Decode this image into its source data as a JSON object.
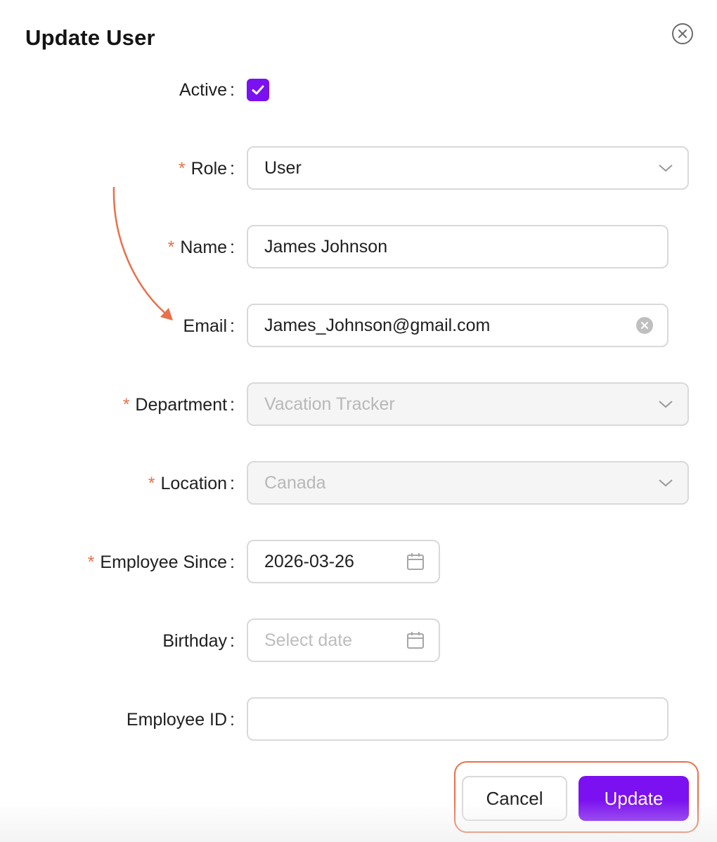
{
  "modal": {
    "title": "Update User",
    "close_icon": "close-circle-icon"
  },
  "form": {
    "active": {
      "label": "Active",
      "required": false,
      "checked": true
    },
    "role": {
      "label": "Role",
      "required": true,
      "value": "User",
      "icon": "chevron-down-icon"
    },
    "name": {
      "label": "Name",
      "required": true,
      "value": "James Johnson"
    },
    "email": {
      "label": "Email",
      "required": false,
      "value": "James_Johnson@gmail.com",
      "icon": "clear-icon"
    },
    "department": {
      "label": "Department",
      "required": true,
      "value": "Vacation Tracker",
      "disabled": true,
      "icon": "chevron-down-icon"
    },
    "location": {
      "label": "Location",
      "required": true,
      "value": "Canada",
      "disabled": true,
      "icon": "chevron-down-icon"
    },
    "employee_since": {
      "label": "Employee Since",
      "required": true,
      "value": "2026-03-26",
      "icon": "calendar-icon"
    },
    "birthday": {
      "label": "Birthday",
      "required": false,
      "value": "",
      "placeholder": "Select date",
      "icon": "calendar-icon"
    },
    "employee_id": {
      "label": "Employee ID",
      "required": false,
      "value": ""
    }
  },
  "footer": {
    "cancel_label": "Cancel",
    "update_label": "Update"
  },
  "colors": {
    "accent": "#7b10f0",
    "required_mark": "#e8704b",
    "annotation": "#e8704b",
    "border": "#d9d9d9",
    "disabled_bg": "#f5f5f5"
  },
  "req_mark": "*",
  "colon": ":"
}
